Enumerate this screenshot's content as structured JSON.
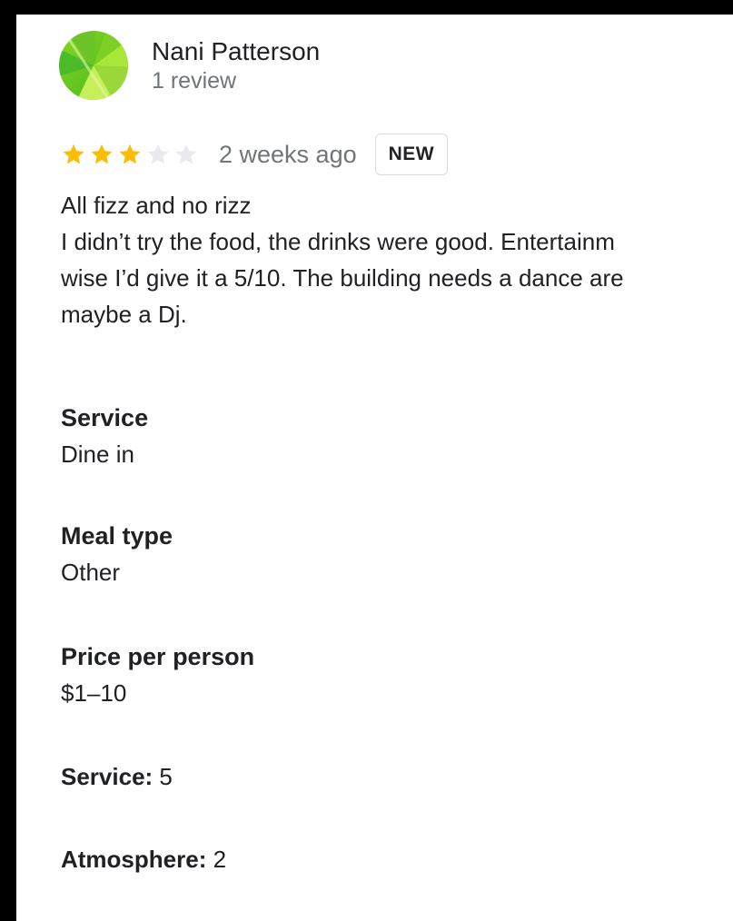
{
  "reviewer": {
    "name": "Nani Patterson",
    "review_count": "1 review"
  },
  "review": {
    "rating": 3,
    "max_rating": 5,
    "date": "2 weeks ago",
    "badge": "NEW",
    "lines": [
      "All fizz and no rizz",
      "I didn’t try the food, the drinks were good. Entertainm",
      "wise I’d give it a 5/10. The building needs a dance are",
      "maybe a Dj."
    ]
  },
  "attributes": [
    {
      "label": "Service",
      "value": "Dine in"
    },
    {
      "label": "Meal type",
      "value": "Other"
    },
    {
      "label": "Price per person",
      "value": "$1–10"
    }
  ],
  "scores": [
    {
      "label": "Service:",
      "value": "5"
    },
    {
      "label": "Atmosphere:",
      "value": "2"
    }
  ],
  "colors": {
    "star_filled": "#fbbc04",
    "star_empty": "#e8eaed",
    "secondary_text": "#70757a"
  }
}
